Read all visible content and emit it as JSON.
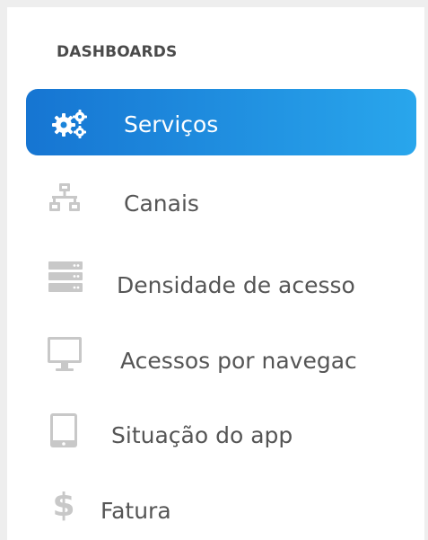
{
  "sidebar": {
    "section_title": "DASHBOARDS",
    "items": [
      {
        "label": "Serviços",
        "icon": "gears-icon",
        "active": true
      },
      {
        "label": "Canais",
        "icon": "network-icon",
        "active": false
      },
      {
        "label": "Densidade de acesso",
        "icon": "server-icon",
        "active": false
      },
      {
        "label": "Acessos por navegac",
        "icon": "desktop-icon",
        "active": false
      },
      {
        "label": "Situação do app",
        "icon": "tablet-icon",
        "active": false
      },
      {
        "label": "Fatura",
        "icon": "dollar-icon",
        "active": false
      }
    ]
  },
  "colors": {
    "background": "#eeeeee",
    "panel": "#ffffff",
    "active_gradient_start": "#1675d2",
    "active_gradient_end": "#29a6ec",
    "text": "#555555",
    "icon_inactive": "#c8c8c8"
  }
}
